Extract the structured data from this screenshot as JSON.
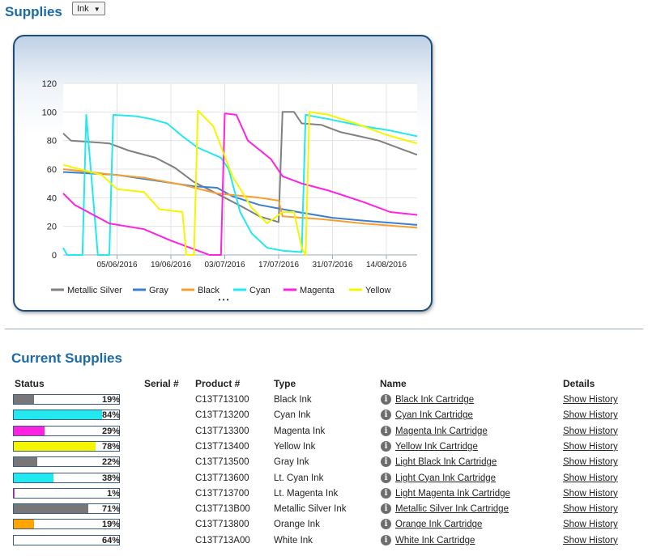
{
  "header": {
    "title": "Supplies",
    "select_value": "Ink"
  },
  "current_supplies": {
    "title": "Current Supplies",
    "columns": [
      "Status",
      "Serial #",
      "Product #",
      "Type",
      "Name",
      "Details"
    ],
    "rows": [
      {
        "level": 19,
        "pct": "19%",
        "color": "#777777",
        "product": "C13T713100",
        "type": "Black Ink",
        "name": "Black Ink Cartridge",
        "details": "Show History"
      },
      {
        "level": 84,
        "pct": "84%",
        "color": "#22e8f0",
        "product": "C13T713200",
        "type": "Cyan Ink",
        "name": "Cyan Ink Cartridge",
        "details": "Show History"
      },
      {
        "level": 29,
        "pct": "29%",
        "color": "#ff22e0",
        "product": "C13T713300",
        "type": "Magenta Ink",
        "name": "Magenta Ink Cartridge",
        "details": "Show History"
      },
      {
        "level": 78,
        "pct": "78%",
        "color": "#f5f500",
        "product": "C13T713400",
        "type": "Yellow Ink",
        "name": "Yellow Ink Cartridge",
        "details": "Show History"
      },
      {
        "level": 22,
        "pct": "22%",
        "color": "#777777",
        "product": "C13T713500",
        "type": "Gray Ink",
        "name": "Light Black Ink Cartridge",
        "details": "Show History"
      },
      {
        "level": 38,
        "pct": "38%",
        "color": "#22e8f0",
        "product": "C13T713600",
        "type": "Lt. Cyan Ink",
        "name": "Light Cyan Ink Cartridge",
        "details": "Show History"
      },
      {
        "level": 1,
        "pct": "1%",
        "color": "#ff22e0",
        "product": "C13T713700",
        "type": "Lt. Magenta Ink",
        "name": "Light Magenta Ink Cartridge",
        "details": "Show History"
      },
      {
        "level": 71,
        "pct": "71%",
        "color": "#777777",
        "product": "C13T713B00",
        "type": "Metallic Silver Ink",
        "name": "Metallic Silver Ink Cartridge",
        "details": "Show History"
      },
      {
        "level": 19,
        "pct": "19%",
        "color": "#ffa500",
        "product": "C13T713800",
        "type": "Orange Ink",
        "name": "Orange Ink Cartridge",
        "details": "Show History"
      },
      {
        "level": 64,
        "pct": "64%",
        "color": "#ffffff",
        "product": "C13T713A00",
        "type": "White Ink",
        "name": "White Ink Cartridge",
        "details": "Show History"
      }
    ]
  },
  "chart_data": {
    "type": "line",
    "y_ticks": [
      "0",
      "20",
      "40",
      "60",
      "80",
      "100",
      "120"
    ],
    "ylim": [
      0,
      120
    ],
    "x_ticks": [
      "05/06/2016",
      "19/06/2016",
      "03/07/2016",
      "17/07/2016",
      "31/07/2016",
      "14/08/2016"
    ],
    "xlim": [
      "2016-05-22",
      "2016-08-22"
    ],
    "grid": true,
    "legend_position": "bottom",
    "more_indicator": "• • •",
    "series": [
      {
        "name": "Metallic Silver",
        "color": "#808080",
        "points": [
          [
            "2016-05-22",
            85
          ],
          [
            "2016-05-24",
            80
          ],
          [
            "2016-06-03",
            78
          ],
          [
            "2016-06-08",
            73
          ],
          [
            "2016-06-15",
            68
          ],
          [
            "2016-06-20",
            61
          ],
          [
            "2016-06-25",
            51
          ],
          [
            "2016-07-03",
            40
          ],
          [
            "2016-07-08",
            33
          ],
          [
            "2016-07-12",
            27
          ],
          [
            "2016-07-17",
            23
          ],
          [
            "2016-07-18",
            100
          ],
          [
            "2016-07-21",
            100
          ],
          [
            "2016-07-23",
            92
          ],
          [
            "2016-07-28",
            91
          ],
          [
            "2016-08-02",
            86
          ],
          [
            "2016-08-07",
            83
          ],
          [
            "2016-08-12",
            80
          ],
          [
            "2016-08-18",
            74
          ],
          [
            "2016-08-22",
            70
          ]
        ]
      },
      {
        "name": "Gray",
        "color": "#3d7fcf",
        "points": [
          [
            "2016-05-22",
            58
          ],
          [
            "2016-06-05",
            56
          ],
          [
            "2016-06-15",
            52
          ],
          [
            "2016-06-25",
            48
          ],
          [
            "2016-07-01",
            47
          ],
          [
            "2016-07-05",
            41
          ],
          [
            "2016-07-12",
            35
          ],
          [
            "2016-07-22",
            30
          ],
          [
            "2016-07-31",
            26
          ],
          [
            "2016-08-08",
            24
          ],
          [
            "2016-08-22",
            21
          ]
        ]
      },
      {
        "name": "Black",
        "color": "#f5a030",
        "points": [
          [
            "2016-05-22",
            60
          ],
          [
            "2016-06-01",
            57
          ],
          [
            "2016-06-12",
            54
          ],
          [
            "2016-06-22",
            49
          ],
          [
            "2016-07-01",
            43
          ],
          [
            "2016-07-12",
            40
          ],
          [
            "2016-07-17",
            38
          ],
          [
            "2016-07-18",
            27
          ],
          [
            "2016-07-28",
            25
          ],
          [
            "2016-08-08",
            22
          ],
          [
            "2016-08-22",
            19
          ]
        ]
      },
      {
        "name": "Cyan",
        "color": "#22e8f0",
        "points": [
          [
            "2016-05-22",
            5
          ],
          [
            "2016-05-23",
            0
          ],
          [
            "2016-05-27",
            0
          ],
          [
            "2016-05-28",
            98
          ],
          [
            "2016-05-31",
            0
          ],
          [
            "2016-06-03",
            0
          ],
          [
            "2016-06-04",
            98
          ],
          [
            "2016-06-10",
            97
          ],
          [
            "2016-06-14",
            95
          ],
          [
            "2016-06-18",
            92
          ],
          [
            "2016-06-22",
            83
          ],
          [
            "2016-06-26",
            75
          ],
          [
            "2016-07-02",
            68
          ],
          [
            "2016-07-04",
            60
          ],
          [
            "2016-07-07",
            30
          ],
          [
            "2016-07-10",
            15
          ],
          [
            "2016-07-14",
            5
          ],
          [
            "2016-07-18",
            3
          ],
          [
            "2016-07-23",
            2
          ],
          [
            "2016-07-24",
            98
          ],
          [
            "2016-07-30",
            95
          ],
          [
            "2016-08-08",
            90
          ],
          [
            "2016-08-15",
            87
          ],
          [
            "2016-08-22",
            83
          ]
        ]
      },
      {
        "name": "Magenta",
        "color": "#ff22e0",
        "points": [
          [
            "2016-05-22",
            43
          ],
          [
            "2016-05-25",
            35
          ],
          [
            "2016-06-03",
            22
          ],
          [
            "2016-06-12",
            18
          ],
          [
            "2016-06-19",
            10
          ],
          [
            "2016-06-24",
            5
          ],
          [
            "2016-06-29",
            0
          ],
          [
            "2016-07-02",
            0
          ],
          [
            "2016-07-03",
            99
          ],
          [
            "2016-07-06",
            98
          ],
          [
            "2016-07-09",
            80
          ],
          [
            "2016-07-15",
            67
          ],
          [
            "2016-07-18",
            55
          ],
          [
            "2016-07-23",
            50
          ],
          [
            "2016-07-30",
            45
          ],
          [
            "2016-08-08",
            37
          ],
          [
            "2016-08-15",
            30
          ],
          [
            "2016-08-22",
            28
          ]
        ]
      },
      {
        "name": "Yellow",
        "color": "#f5f500",
        "points": [
          [
            "2016-05-22",
            63
          ],
          [
            "2016-06-01",
            56
          ],
          [
            "2016-06-05",
            46
          ],
          [
            "2016-06-12",
            44
          ],
          [
            "2016-06-16",
            32
          ],
          [
            "2016-06-22",
            30
          ],
          [
            "2016-06-23",
            0
          ],
          [
            "2016-06-25",
            0
          ],
          [
            "2016-06-26",
            101
          ],
          [
            "2016-06-30",
            90
          ],
          [
            "2016-07-05",
            55
          ],
          [
            "2016-07-10",
            33
          ],
          [
            "2016-07-14",
            22
          ],
          [
            "2016-07-18",
            30
          ],
          [
            "2016-07-21",
            30
          ],
          [
            "2016-07-23",
            5
          ],
          [
            "2016-07-24",
            0
          ],
          [
            "2016-07-25",
            100
          ],
          [
            "2016-07-30",
            98
          ],
          [
            "2016-08-06",
            92
          ],
          [
            "2016-08-14",
            84
          ],
          [
            "2016-08-22",
            78
          ]
        ]
      }
    ]
  }
}
